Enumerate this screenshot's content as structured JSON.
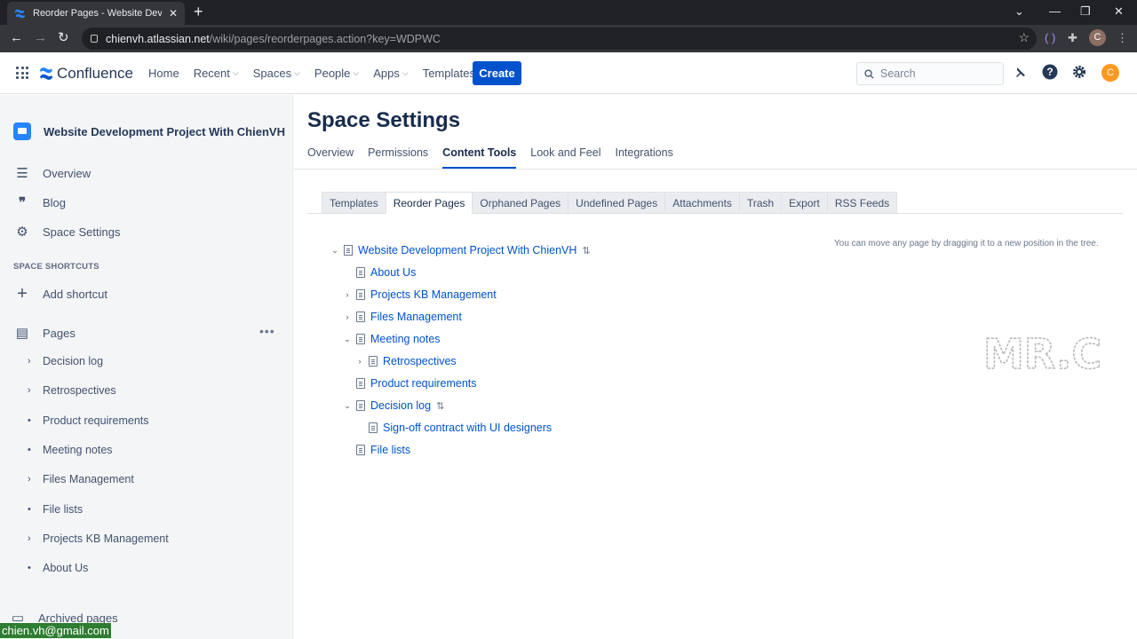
{
  "browser": {
    "tab_title": "Reorder Pages - Website Develop",
    "url_host": "chienvh.atlassian.net",
    "url_path": "/wiki/pages/reorderpages.action?key=WDPWC",
    "profile_initial": "C"
  },
  "header": {
    "logo": "Confluence",
    "nav": [
      {
        "label": "Home",
        "dropdown": false
      },
      {
        "label": "Recent",
        "dropdown": true
      },
      {
        "label": "Spaces",
        "dropdown": true
      },
      {
        "label": "People",
        "dropdown": true
      },
      {
        "label": "Apps",
        "dropdown": true
      },
      {
        "label": "Templates",
        "dropdown": false
      }
    ],
    "create_label": "Create",
    "search_placeholder": "Search",
    "avatar_initial": "C"
  },
  "sidebar": {
    "space_name": "Website Development Project With ChienVH",
    "links": [
      {
        "label": "Overview",
        "icon": "overview-icon"
      },
      {
        "label": "Blog",
        "icon": "quote-icon"
      },
      {
        "label": "Space Settings",
        "icon": "gear-icon"
      }
    ],
    "shortcuts_heading": "SPACE SHORTCUTS",
    "add_shortcut": "Add shortcut",
    "pages_label": "Pages",
    "page_tree": [
      {
        "label": "Decision log",
        "marker": "chevron"
      },
      {
        "label": "Retrospectives",
        "marker": "chevron"
      },
      {
        "label": "Product requirements",
        "marker": "bullet"
      },
      {
        "label": "Meeting notes",
        "marker": "bullet"
      },
      {
        "label": "Files Management",
        "marker": "chevron"
      },
      {
        "label": "File lists",
        "marker": "bullet"
      },
      {
        "label": "Projects KB Management",
        "marker": "chevron"
      },
      {
        "label": "About Us",
        "marker": "bullet"
      }
    ],
    "archived_pages": "Archived pages"
  },
  "overlay_email": "chien.vh@gmail.com",
  "main": {
    "title": "Space Settings",
    "tabs": [
      "Overview",
      "Permissions",
      "Content Tools",
      "Look and Feel",
      "Integrations"
    ],
    "active_tab": "Content Tools",
    "subtabs": [
      "Templates",
      "Reorder Pages",
      "Orphaned Pages",
      "Undefined Pages",
      "Attachments",
      "Trash",
      "Export",
      "RSS Feeds"
    ],
    "active_subtab": "Reorder Pages",
    "hint": "You can move any page by dragging it to a new position in the tree.",
    "tree": [
      {
        "label": "Website Development Project With ChienVH",
        "depth": 0,
        "toggle": "expanded",
        "sort": true
      },
      {
        "label": "About Us",
        "depth": 1,
        "toggle": "none",
        "sort": false
      },
      {
        "label": "Projects KB Management",
        "depth": 1,
        "toggle": "collapsed",
        "sort": false
      },
      {
        "label": "Files Management",
        "depth": 1,
        "toggle": "collapsed",
        "sort": false
      },
      {
        "label": "Meeting notes",
        "depth": 1,
        "toggle": "expanded",
        "sort": false
      },
      {
        "label": "Retrospectives",
        "depth": 2,
        "toggle": "collapsed",
        "sort": false
      },
      {
        "label": "Product requirements",
        "depth": 1,
        "toggle": "none",
        "sort": false
      },
      {
        "label": "Decision log",
        "depth": 1,
        "toggle": "expanded",
        "sort": true
      },
      {
        "label": "Sign-off contract with UI designers",
        "depth": 2,
        "toggle": "none",
        "sort": false
      },
      {
        "label": "File lists",
        "depth": 1,
        "toggle": "none",
        "sort": false
      }
    ],
    "watermark": "MR.C"
  },
  "colors": {
    "primary": "#0052cc",
    "link": "#0052cc",
    "sidebar_bg": "#f4f5f7",
    "avatar": "#ff991f"
  }
}
